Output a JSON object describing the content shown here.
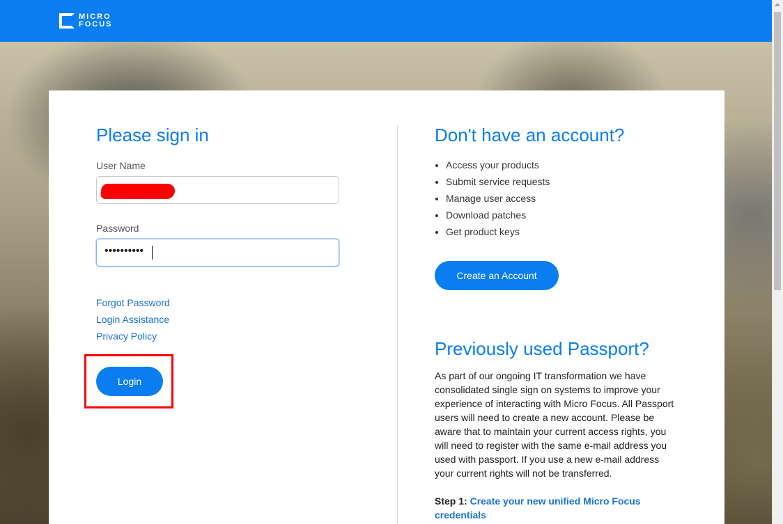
{
  "header": {
    "brand_line1": "MICRO",
    "brand_line2": "FOCUS"
  },
  "signin": {
    "title": "Please sign in",
    "username_label": "User Name",
    "username_value": "",
    "password_label": "Password",
    "password_value": "••••••••••",
    "links": [
      "Forgot Password",
      "Login Assistance",
      "Privacy Policy"
    ],
    "login_button": "Login"
  },
  "account": {
    "title": "Don't have an account?",
    "benefits": [
      "Access your products",
      "Submit service requests",
      "Manage user access",
      "Download patches",
      "Get product keys"
    ],
    "create_button": "Create an Account"
  },
  "passport": {
    "title": "Previously used Passport?",
    "body": "As part of our ongoing IT transformation we have consolidated single sign on systems to improve your experience of interacting with Micro Focus. All Passport users will need to create a new account. Please be aware that to maintain your current access rights, you will need to register with the same e-mail address you used with passport. If you use a new e-mail address your current rights will not be transferred.",
    "step_label": "Step 1:",
    "step_link": "Create your new unified Micro Focus credentials"
  },
  "colors": {
    "brand_blue": "#0a7ef0",
    "link_blue": "#1a73d9",
    "highlight_red": "#ff0000"
  }
}
